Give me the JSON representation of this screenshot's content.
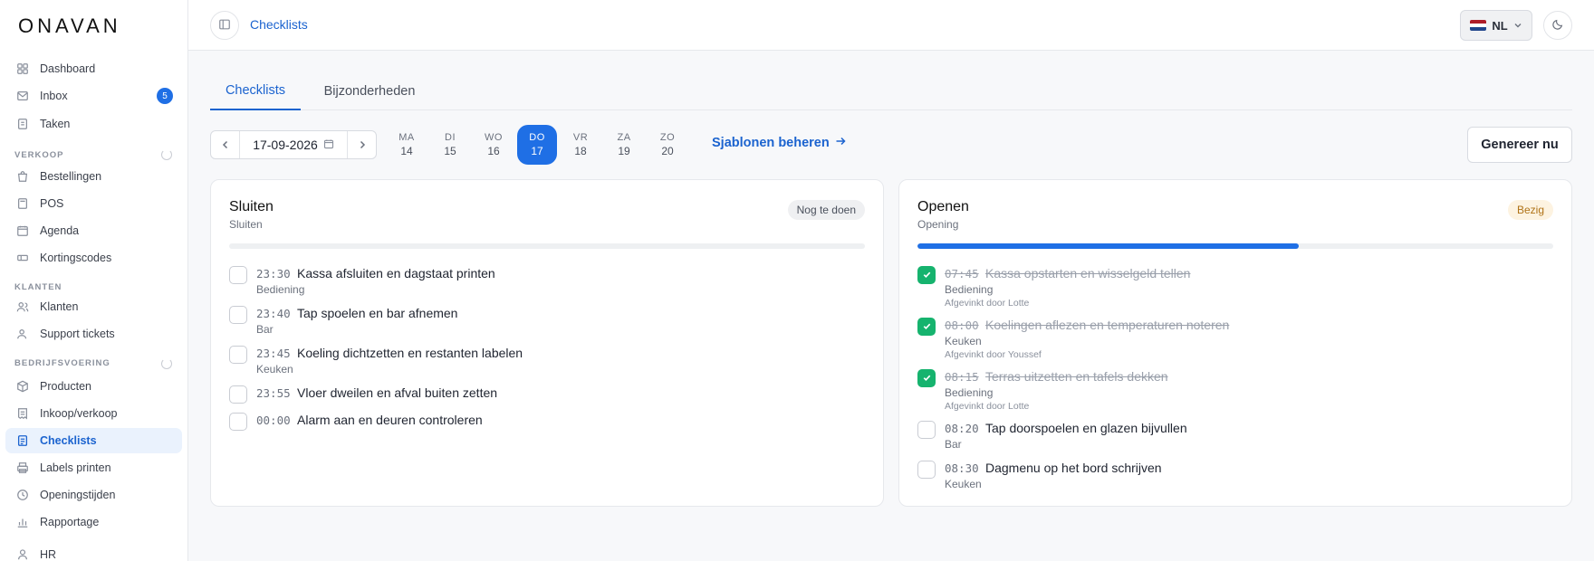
{
  "app": {
    "logo": "ONAVAN"
  },
  "sidebar": {
    "items": [
      {
        "label": "Dashboard",
        "icon": "grid-icon"
      },
      {
        "label": "Inbox",
        "icon": "inbox-icon",
        "badge": "5"
      },
      {
        "label": "Taken",
        "icon": "clipboard-icon"
      },
      {
        "label": "Bestellingen",
        "icon": "bag-icon"
      },
      {
        "label": "POS",
        "icon": "pos-icon"
      },
      {
        "label": "Agenda",
        "icon": "calendar-icon"
      },
      {
        "label": "Kortingscodes",
        "icon": "ticket-icon"
      },
      {
        "label": "Klanten",
        "icon": "users-icon"
      },
      {
        "label": "Support tickets",
        "icon": "support-icon"
      },
      {
        "label": "Producten",
        "icon": "box-icon"
      },
      {
        "label": "Inkoop/verkoop",
        "icon": "receipt-icon"
      },
      {
        "label": "Checklists",
        "icon": "checklist-icon",
        "active": true
      },
      {
        "label": "Labels printen",
        "icon": "printer-icon"
      },
      {
        "label": "Openingstijden",
        "icon": "clock-icon"
      },
      {
        "label": "Rapportage",
        "icon": "chart-icon"
      },
      {
        "label": "HR",
        "icon": "person-icon"
      }
    ],
    "sections": [
      "VERKOOP",
      "KLANTEN",
      "BEDRIJFSVOERING"
    ]
  },
  "header": {
    "title": "Checklists",
    "language": "NL"
  },
  "tabs": [
    {
      "label": "Checklists"
    },
    {
      "label": "Bijzonderheden"
    }
  ],
  "date": {
    "value": "17-09-2026"
  },
  "week": [
    {
      "day": "MA",
      "num": "14"
    },
    {
      "day": "DI",
      "num": "15"
    },
    {
      "day": "WO",
      "num": "16"
    },
    {
      "day": "DO",
      "num": "17"
    },
    {
      "day": "VR",
      "num": "18"
    },
    {
      "day": "ZA",
      "num": "19"
    },
    {
      "day": "ZO",
      "num": "20"
    }
  ],
  "actions": {
    "templates": "Sjablonen beheren",
    "generate": "Genereer nu"
  },
  "checklists": [
    {
      "title": "Sluiten",
      "subtitle": "Sluiten",
      "status": "Nog te doen",
      "progress": 0,
      "tasks": [
        {
          "time": "23:30",
          "label": "Kassa afsluiten en dagstaat printen",
          "category": "Bediening"
        },
        {
          "time": "23:40",
          "label": "Tap spoelen en bar afnemen",
          "category": "Bar"
        },
        {
          "time": "23:45",
          "label": "Koeling dichtzetten en restanten labelen",
          "category": "Keuken"
        },
        {
          "time": "23:55",
          "label": "Vloer dweilen en afval buiten zetten",
          "category": ""
        },
        {
          "time": "00:00",
          "label": "Alarm aan en deuren controleren",
          "category": ""
        }
      ]
    },
    {
      "title": "Openen",
      "subtitle": "Opening",
      "status": "Bezig",
      "progress": 0.6,
      "tasks": [
        {
          "time": "07:45",
          "label": "Kassa opstarten en wisselgeld tellen",
          "category": "Bediening",
          "done": true,
          "by": "Afgevinkt door Lotte"
        },
        {
          "time": "08:00",
          "label": "Koelingen aflezen en temperaturen noteren",
          "category": "Keuken",
          "done": true,
          "by": "Afgevinkt door Youssef"
        },
        {
          "time": "08:15",
          "label": "Terras uitzetten en tafels dekken",
          "category": "Bediening",
          "done": true,
          "by": "Afgevinkt door Lotte"
        },
        {
          "time": "08:20",
          "label": "Tap doorspoelen en glazen bijvullen",
          "category": "Bar"
        },
        {
          "time": "08:30",
          "label": "Dagmenu op het bord schrijven",
          "category": "Keuken"
        }
      ]
    }
  ],
  "colors": {
    "accent": "#1f6fe5",
    "done": "#16b36e",
    "busy": "#b07317"
  }
}
